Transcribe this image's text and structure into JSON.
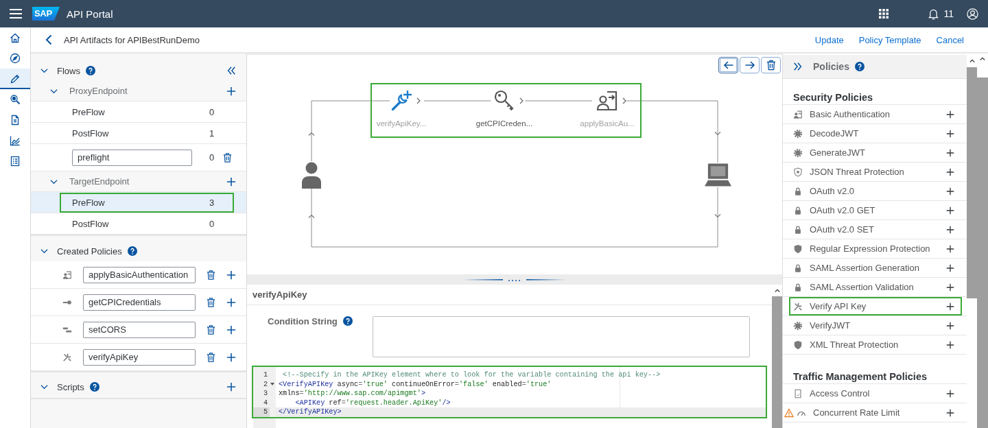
{
  "shell": {
    "logo": "SAP",
    "title": "API Portal",
    "notification_count": "11"
  },
  "nav_rail": [
    {
      "kind": "home",
      "selected": false
    },
    {
      "kind": "compass",
      "selected": false
    },
    {
      "kind": "pencil",
      "selected": true
    },
    {
      "kind": "magnifier",
      "selected": false
    },
    {
      "kind": "document",
      "selected": false
    },
    {
      "kind": "chart",
      "selected": false
    },
    {
      "kind": "checklist",
      "selected": false
    }
  ],
  "page_header": {
    "title": "API Artifacts for APIBestRunDemo",
    "actions": [
      "Update",
      "Policy Template",
      "Cancel"
    ]
  },
  "flows": {
    "title": "Flows",
    "expanded": true,
    "endpoints": [
      {
        "name": "ProxyEndpoint",
        "expanded": true,
        "rows": [
          {
            "kind": "flow",
            "name": "PreFlow",
            "count": "0",
            "selected": false,
            "highlighted": false
          },
          {
            "kind": "flow",
            "name": "PostFlow",
            "count": "1",
            "selected": false,
            "highlighted": false
          },
          {
            "kind": "conditional",
            "name": "preflight",
            "count": "0",
            "selected": false,
            "highlighted": false
          }
        ]
      },
      {
        "name": "TargetEndpoint",
        "expanded": true,
        "rows": [
          {
            "kind": "flow",
            "name": "PreFlow",
            "count": "3",
            "selected": true,
            "highlighted": true
          },
          {
            "kind": "flow",
            "name": "PostFlow",
            "count": "0",
            "selected": false,
            "highlighted": false
          }
        ]
      }
    ]
  },
  "created_policies": {
    "title": "Created Policies",
    "expanded": true,
    "items": [
      {
        "kind": "person-arrow",
        "name": "applyBasicAuthentication"
      },
      {
        "kind": "key",
        "name": "getCPICredentials"
      },
      {
        "kind": "bars",
        "name": "setCORS"
      },
      {
        "kind": "tools",
        "name": "verifyApiKey"
      }
    ]
  },
  "scripts": {
    "title": "Scripts",
    "expanded": true
  },
  "flow_canvas": {
    "toolbar": [
      {
        "kind": "arrow-left",
        "focused": true
      },
      {
        "kind": "arrow-right",
        "focused": false
      },
      {
        "kind": "trash",
        "focused": false
      }
    ],
    "steps_highlighted": true,
    "steps": [
      {
        "kind": "wrench-plus",
        "label": "verifyApiKey...",
        "selected": true,
        "dimmed": true
      },
      {
        "kind": "key",
        "label": "getCPICreden...",
        "selected": false,
        "dimmed": false
      },
      {
        "kind": "person-arrow",
        "label": "applyBasicAu...",
        "selected": false,
        "dimmed": true
      }
    ]
  },
  "policy_detail": {
    "title": "verifyApiKey",
    "condition_label": "Condition String",
    "code_highlighted": true,
    "code_lines": [
      {
        "number": "1",
        "fold": false,
        "active": false,
        "tokens": [
          {
            "kind": "comment",
            "text": " <!--Specify in the APIKey element where to look for the variable containing the api key-->"
          }
        ]
      },
      {
        "number": "2",
        "fold": true,
        "active": false,
        "tokens": [
          {
            "kind": "tag",
            "text": "<VerifyAPIKey"
          },
          {
            "kind": "attr",
            "text": " async"
          },
          {
            "kind": "op",
            "text": "="
          },
          {
            "kind": "string",
            "text": "'true'"
          },
          {
            "kind": "attr",
            "text": " continueOnError"
          },
          {
            "kind": "op",
            "text": "="
          },
          {
            "kind": "string",
            "text": "'false'"
          },
          {
            "kind": "attr",
            "text": " enabled"
          },
          {
            "kind": "op",
            "text": "="
          },
          {
            "kind": "string",
            "text": "'true'"
          }
        ]
      },
      {
        "number": "3",
        "fold": false,
        "active": false,
        "tokens": [
          {
            "kind": "attr",
            "text": "xmlns"
          },
          {
            "kind": "op",
            "text": "="
          },
          {
            "kind": "string",
            "text": "'http://www.sap.com/apimgmt'"
          },
          {
            "kind": "tag",
            "text": ">"
          }
        ]
      },
      {
        "number": "4",
        "fold": false,
        "active": false,
        "tokens": [
          {
            "kind": "tag",
            "text": "    <APIKey"
          },
          {
            "kind": "attr",
            "text": " ref"
          },
          {
            "kind": "op",
            "text": "="
          },
          {
            "kind": "string",
            "text": "'request.header.ApiKey'"
          },
          {
            "kind": "tag",
            "text": "/>"
          }
        ]
      },
      {
        "number": "5",
        "fold": false,
        "active": true,
        "tokens": [
          {
            "kind": "tag",
            "text": "</VerifyAPIKey>"
          }
        ]
      }
    ]
  },
  "policies_panel": {
    "title": "Policies",
    "groups": [
      {
        "title": "Security Policies",
        "items": [
          {
            "kind": "person-arrow",
            "name": "Basic Authentication",
            "highlighted": false,
            "warning": false
          },
          {
            "kind": "gear",
            "name": "DecodeJWT",
            "highlighted": false,
            "warning": false
          },
          {
            "kind": "gear",
            "name": "GenerateJWT",
            "highlighted": false,
            "warning": false
          },
          {
            "kind": "badge",
            "name": "JSON Threat Protection",
            "highlighted": false,
            "warning": false
          },
          {
            "kind": "lock",
            "name": "OAuth v2.0",
            "highlighted": false,
            "warning": false
          },
          {
            "kind": "lock",
            "name": "OAuth v2.0 GET",
            "highlighted": false,
            "warning": false
          },
          {
            "kind": "lock",
            "name": "OAuth v2.0 SET",
            "highlighted": false,
            "warning": false
          },
          {
            "kind": "shield",
            "name": "Regular Expression Protection",
            "highlighted": false,
            "warning": false
          },
          {
            "kind": "lock",
            "name": "SAML Assertion Generation",
            "highlighted": false,
            "warning": false
          },
          {
            "kind": "lock",
            "name": "SAML Assertion Validation",
            "highlighted": false,
            "warning": false
          },
          {
            "kind": "tools",
            "name": "Verify API Key",
            "highlighted": true,
            "warning": false
          },
          {
            "kind": "gear",
            "name": "VerifyJWT",
            "highlighted": false,
            "warning": false
          },
          {
            "kind": "shield",
            "name": "XML Threat Protection",
            "highlighted": false,
            "warning": false
          }
        ]
      },
      {
        "title": "Traffic Management Policies",
        "items": [
          {
            "kind": "document",
            "name": "Access Control",
            "highlighted": false,
            "warning": false
          },
          {
            "kind": "gauge",
            "name": "Concurrent Rate Limit",
            "highlighted": false,
            "warning": true
          }
        ]
      }
    ]
  }
}
